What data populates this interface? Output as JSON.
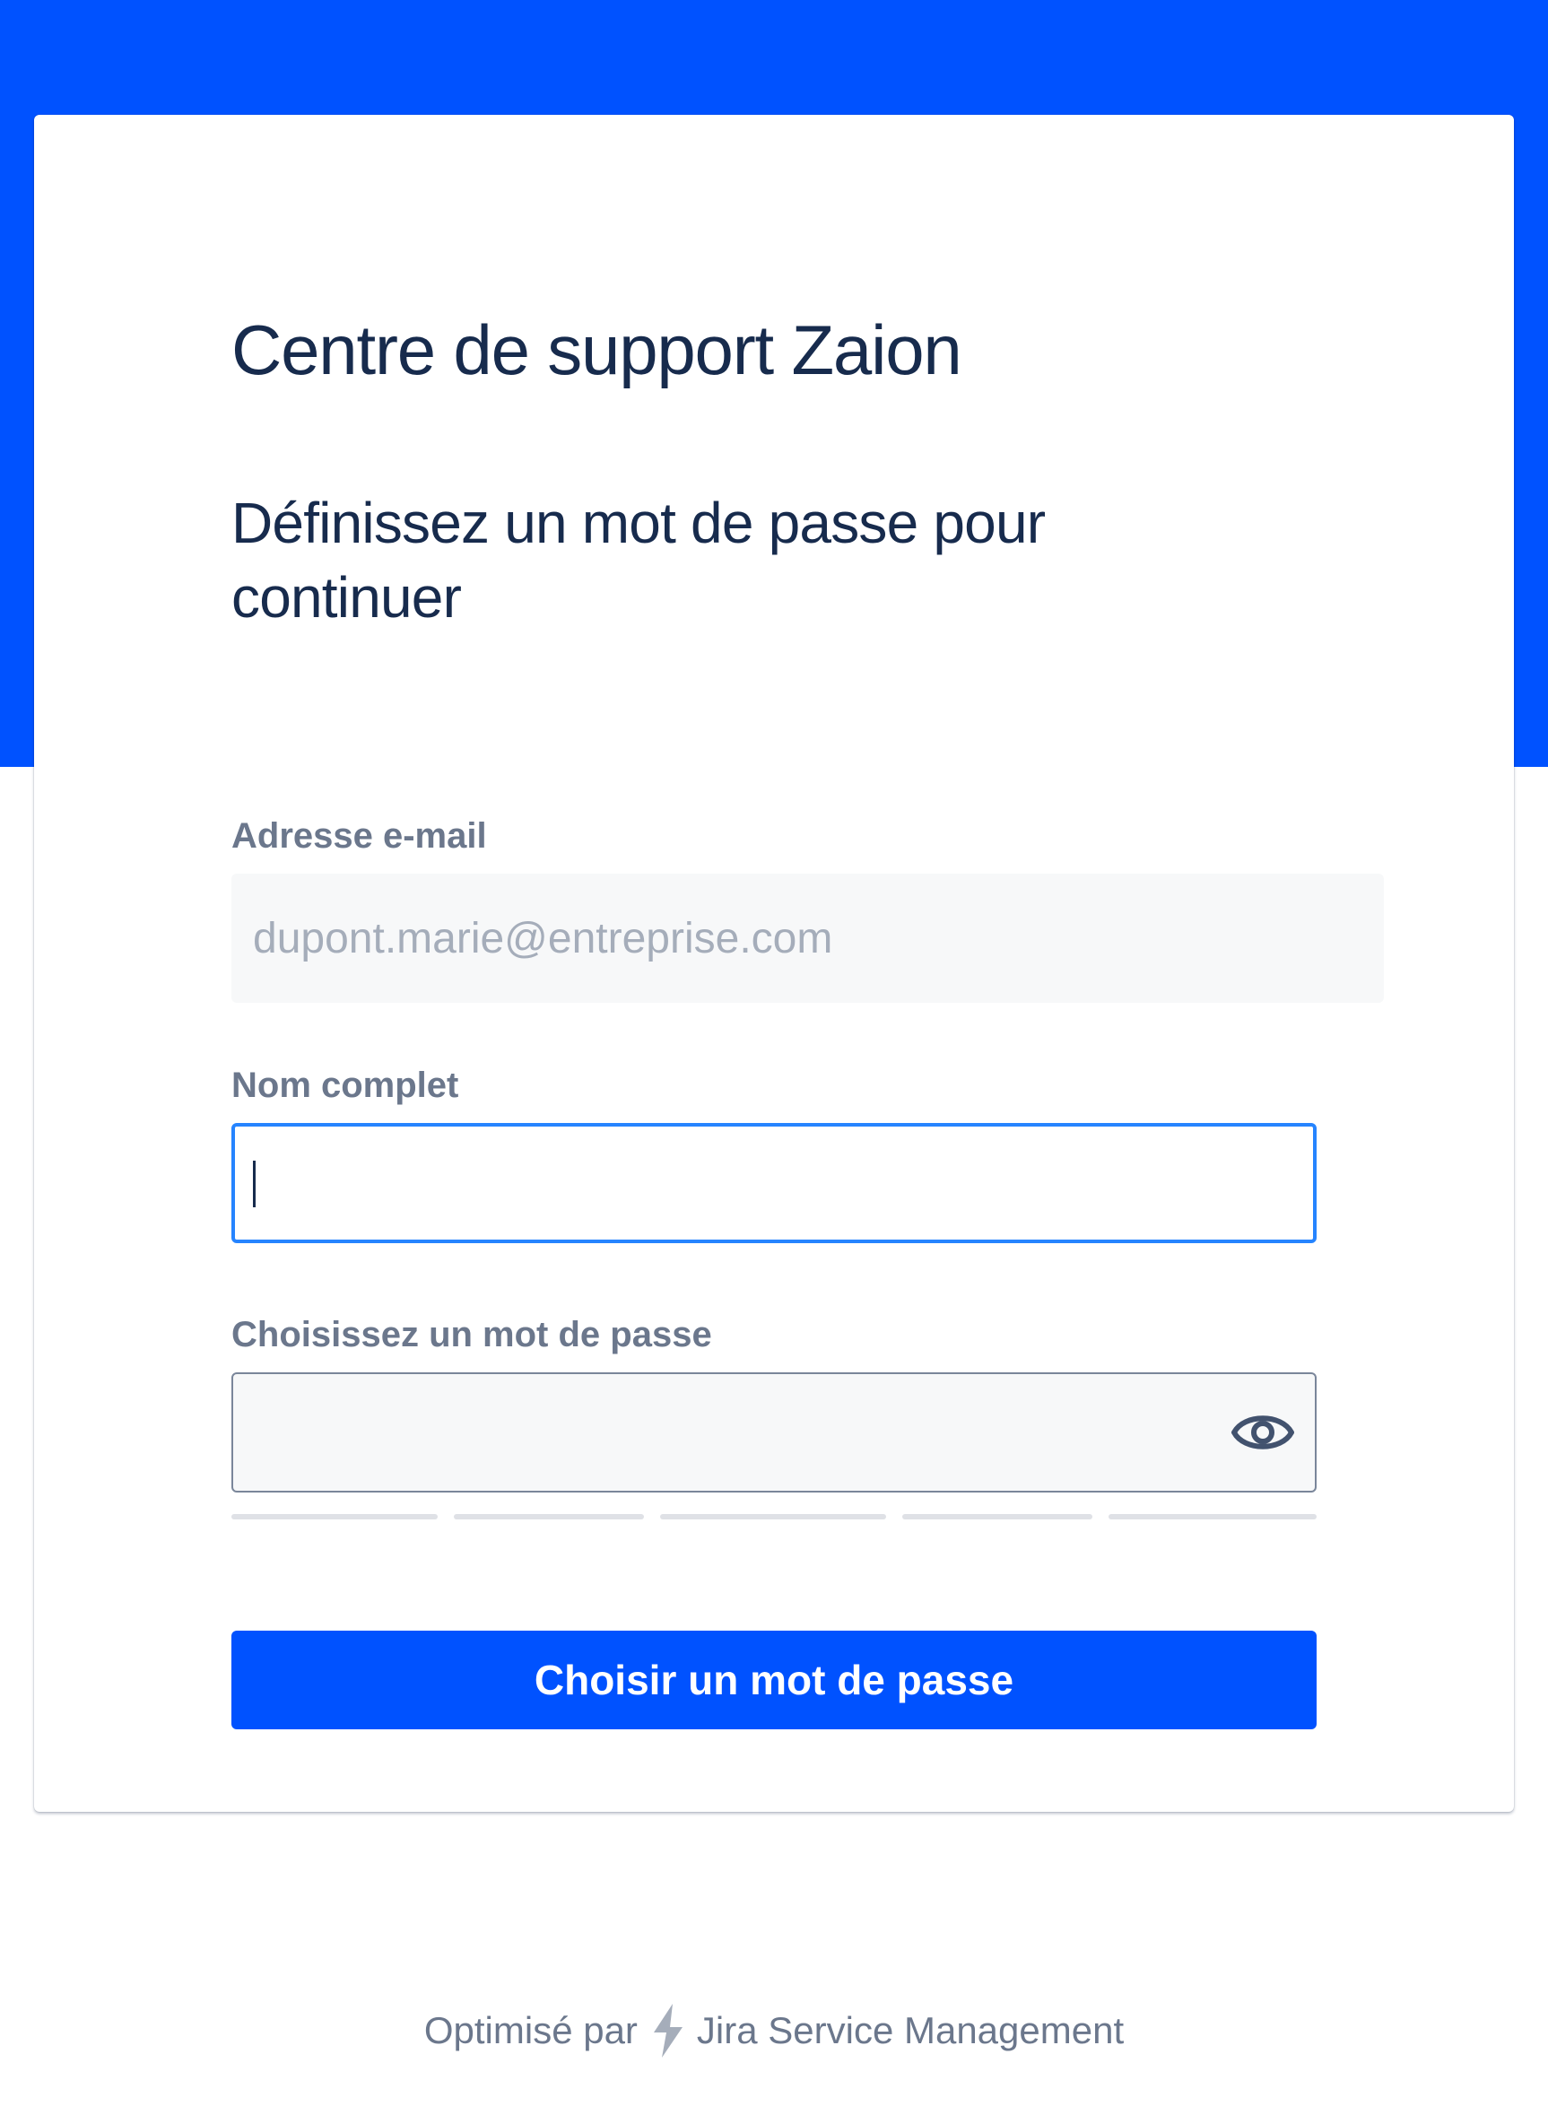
{
  "colors": {
    "brand_blue": "#0052ff",
    "focus_border": "#2684ff",
    "heading_text": "#172b4d",
    "label_text": "#6b778c"
  },
  "portal": {
    "title": "Centre de support Zaion"
  },
  "form": {
    "heading": "Définissez un mot de passe pour continuer",
    "email_label": "Adresse e-mail",
    "email_value": "dupont.marie@entreprise.com",
    "name_label": "Nom complet",
    "name_value": "",
    "password_label": "Choisissez un mot de passe",
    "password_value": "",
    "password_toggle_icon": "eye-icon",
    "password_strength_segments": 5,
    "password_strength_filled": 0,
    "submit_label": "Choisir un mot de passe"
  },
  "footer": {
    "prefix": "Optimisé par",
    "logo_icon": "bolt-icon",
    "product": "Jira Service Management"
  }
}
